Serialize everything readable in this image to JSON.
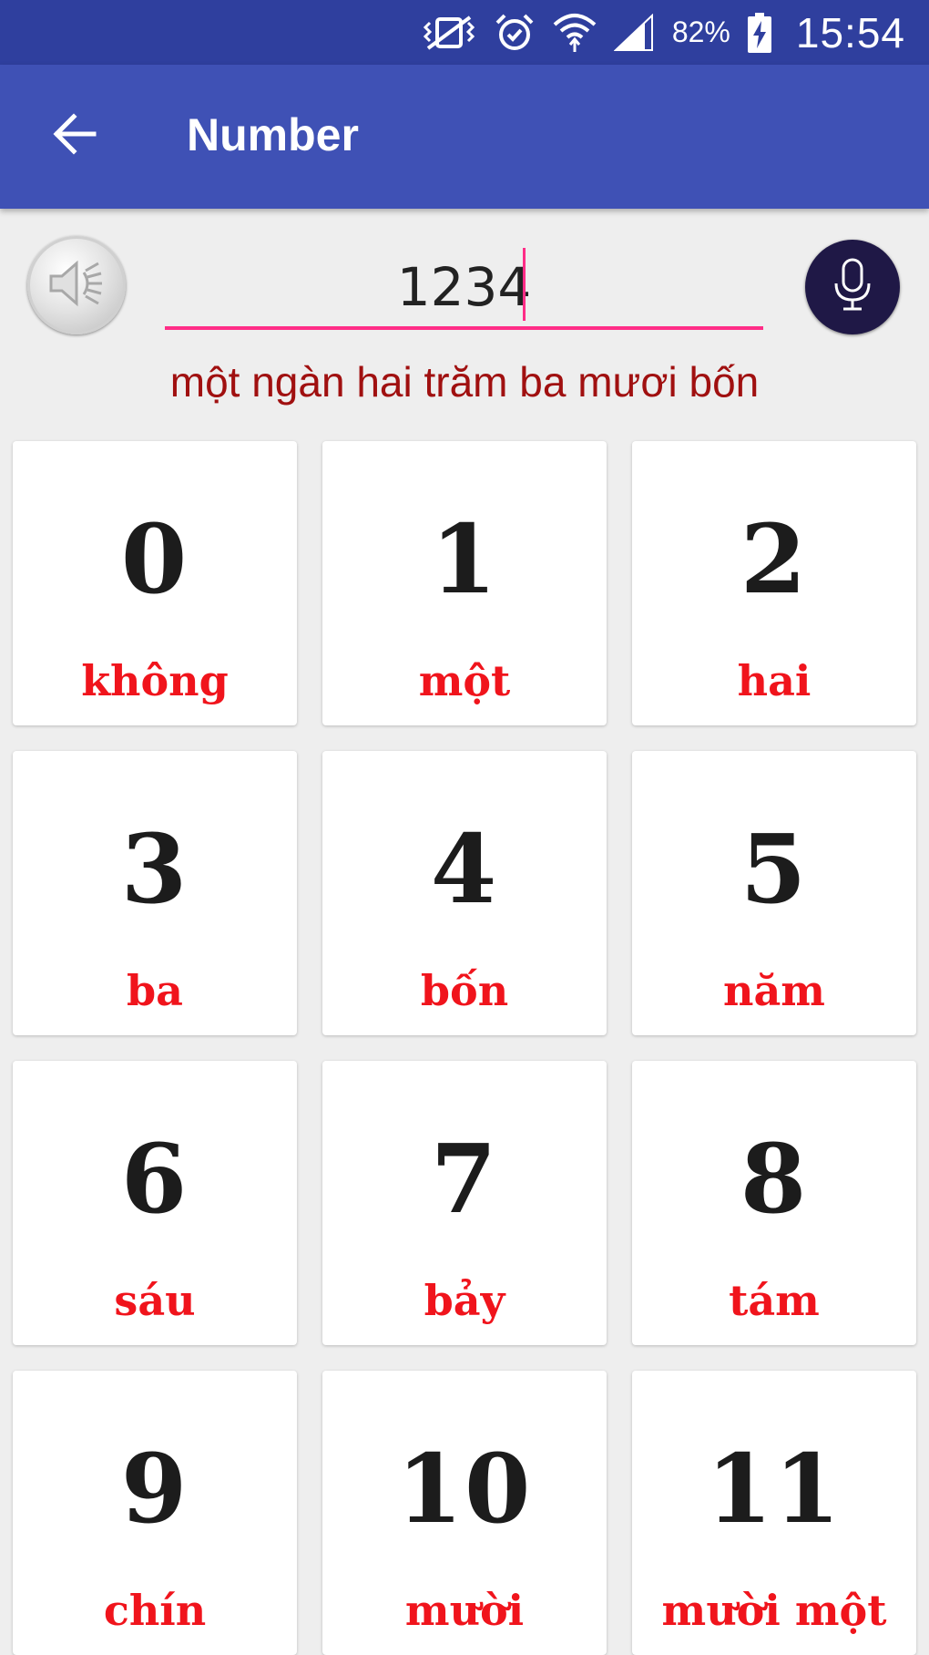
{
  "status_bar": {
    "battery_percent": "82%",
    "time": "15:54",
    "icons": [
      "vibrate-off-icon",
      "alarm-icon",
      "wifi-icon",
      "signal-icon",
      "battery-charging-icon"
    ]
  },
  "app_bar": {
    "title": "Number",
    "back_icon": "arrow-left-icon"
  },
  "converter": {
    "input_value": "1234",
    "spelled_text": "một ngàn hai trăm ba mươi bốn",
    "speaker_icon": "speaker-icon",
    "mic_icon": "microphone-icon"
  },
  "colors": {
    "status_bar": "#2f3f9e",
    "app_bar": "#3f51b5",
    "accent": "#ff2d87",
    "spelled_text": "#a01010",
    "word": "#f0141c",
    "mic_button": "#1f1846"
  },
  "numbers": [
    {
      "digit": "0",
      "word": "không"
    },
    {
      "digit": "1",
      "word": "một"
    },
    {
      "digit": "2",
      "word": "hai"
    },
    {
      "digit": "3",
      "word": "ba"
    },
    {
      "digit": "4",
      "word": "bốn"
    },
    {
      "digit": "5",
      "word": "năm"
    },
    {
      "digit": "6",
      "word": "sáu"
    },
    {
      "digit": "7",
      "word": "bảy"
    },
    {
      "digit": "8",
      "word": "tám"
    },
    {
      "digit": "9",
      "word": "chín"
    },
    {
      "digit": "10",
      "word": "mười"
    },
    {
      "digit": "11",
      "word": "mười một"
    }
  ]
}
